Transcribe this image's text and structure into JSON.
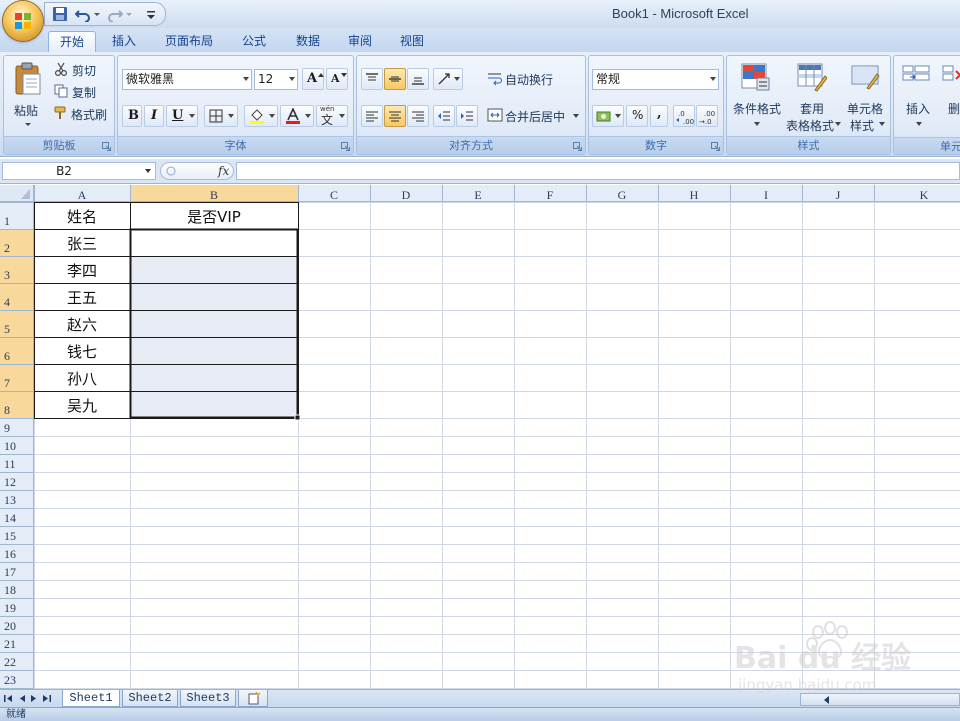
{
  "window": {
    "title": "Book1 - Microsoft Excel"
  },
  "ribbon": {
    "tabs": [
      {
        "label": "开始",
        "active": true
      },
      {
        "label": "插入",
        "active": false
      },
      {
        "label": "页面布局",
        "active": false
      },
      {
        "label": "公式",
        "active": false
      },
      {
        "label": "数据",
        "active": false
      },
      {
        "label": "审阅",
        "active": false
      },
      {
        "label": "视图",
        "active": false
      }
    ],
    "clipboard": {
      "paste": "粘贴",
      "cut": "剪切",
      "copy": "复制",
      "format_painter": "格式刷",
      "group_label": "剪贴板"
    },
    "font": {
      "name": "微软雅黑",
      "size": "12",
      "grow": "A",
      "shrink": "A",
      "bold": "B",
      "italic": "I",
      "underline": "U",
      "phonetic": "文",
      "group_label": "字体"
    },
    "alignment": {
      "wrap_text": "自动换行",
      "merge_center": "合并后居中",
      "group_label": "对齐方式"
    },
    "number": {
      "format": "常规",
      "percent": "%",
      "comma": ",",
      "group_label": "数字"
    },
    "styles": {
      "conditional_formatting": "条件格式",
      "format_as_table_1": "套用",
      "format_as_table_2": "表格格式",
      "cell_styles_1": "单元格",
      "cell_styles_2": "样式",
      "group_label": "样式"
    },
    "cells": {
      "insert": "插入",
      "delete": "删",
      "group_label": "单元"
    }
  },
  "formula_bar": {
    "name_box": "B2",
    "fx_label": "fx",
    "content": ""
  },
  "grid": {
    "columns": [
      "A",
      "B",
      "C",
      "D",
      "E",
      "F",
      "G",
      "H",
      "I",
      "J",
      "K"
    ],
    "row_numbers": [
      "1",
      "2",
      "3",
      "4",
      "5",
      "6",
      "7",
      "8",
      "9",
      "10",
      "11",
      "12",
      "13",
      "14",
      "15",
      "16",
      "17",
      "18",
      "19",
      "20",
      "21",
      "22",
      "23"
    ],
    "header_row": {
      "A": "姓名",
      "B": "是否VIP"
    },
    "names": [
      "张三",
      "李四",
      "王五",
      "赵六",
      "钱七",
      "孙八",
      "吴九"
    ],
    "selection": "B2:B8",
    "colors": {
      "header_bg": "#e4ecf7",
      "header_selected_bg": "#f9d99b",
      "selection_fill": "#e6ebf4",
      "gridline": "#d0d7e5"
    }
  },
  "sheets": {
    "tabs": [
      "Sheet1",
      "Sheet2",
      "Sheet3"
    ],
    "active": "Sheet1"
  },
  "status": {
    "text": "就绪"
  },
  "watermark": {
    "brand": "Bai du 经验",
    "url": "jingyan.baidu.com"
  }
}
